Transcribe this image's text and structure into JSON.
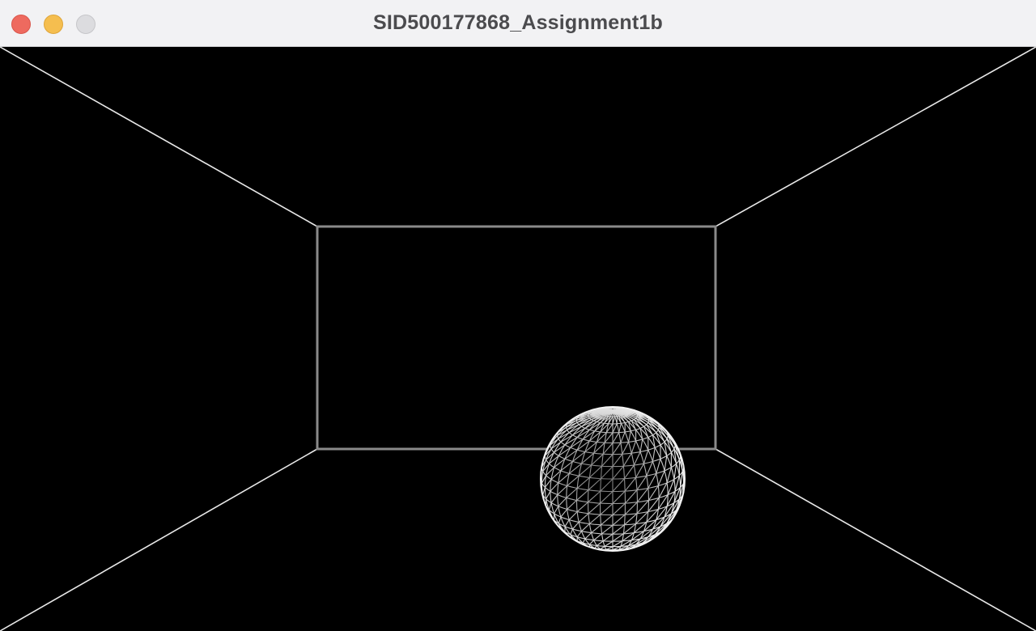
{
  "window": {
    "title": "SID500177868_Assignment1b",
    "controls": [
      "close-icon",
      "minimize-icon",
      "zoom-icon"
    ]
  },
  "scene": {
    "background": "#000000",
    "edge_color": "#ffffff",
    "back_wall_color": "#8a8a8a",
    "sphere_color": "#ffffff",
    "sphere_style": "wireframe"
  }
}
